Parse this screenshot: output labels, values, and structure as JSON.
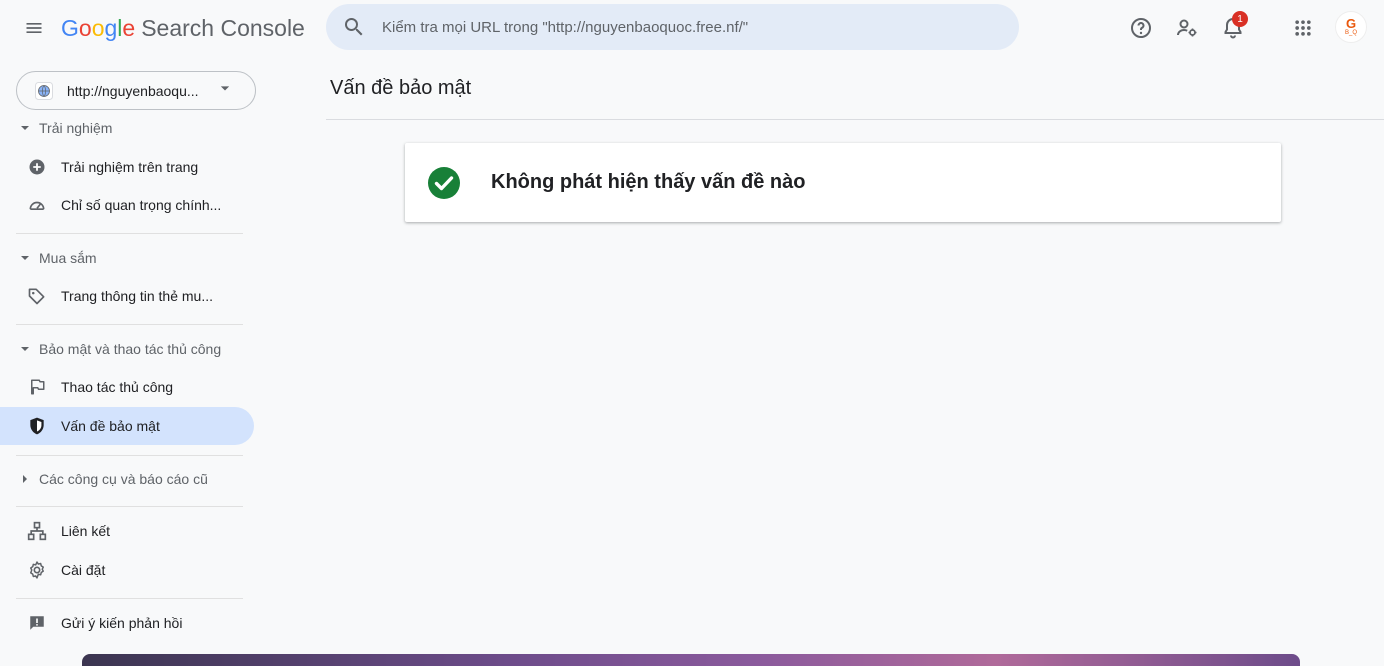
{
  "header": {
    "logo": {
      "g1": "G",
      "g2": "o",
      "g3": "o",
      "g4": "g",
      "g5": "l",
      "g6": "e",
      "product": "Search Console"
    },
    "search_placeholder": "Kiểm tra mọi URL trong \"http://nguyenbaoquoc.free.nf/\"",
    "notification_count": "1",
    "avatar_text": "B_Q",
    "icons": [
      "menu-icon",
      "search-icon",
      "help-icon",
      "manage-users-icon",
      "bell-icon",
      "apps-grid-icon"
    ]
  },
  "sidebar": {
    "property_label": "http://nguyenbaoqu...",
    "sections": [
      {
        "title": "Trải nghiệm",
        "expanded": true,
        "items": [
          {
            "label": "Trải nghiệm trên trang",
            "icon": "plus-circle-icon"
          },
          {
            "label": "Chỉ số quan trọng chính...",
            "icon": "speedometer-icon"
          }
        ]
      },
      {
        "title": "Mua sắm",
        "expanded": true,
        "items": [
          {
            "label": "Trang thông tin thẻ mu...",
            "icon": "tag-icon"
          }
        ]
      },
      {
        "title": "Bảo mật và thao tác thủ công",
        "expanded": true,
        "items": [
          {
            "label": "Thao tác thủ công",
            "icon": "flag-icon"
          },
          {
            "label": "Vấn đề bảo mật",
            "icon": "shield-icon",
            "active": true
          }
        ]
      },
      {
        "title": "Các công cụ và báo cáo cũ",
        "expanded": false,
        "items": []
      }
    ],
    "bottom_items": [
      {
        "label": "Liên kết",
        "icon": "links-icon"
      },
      {
        "label": "Cài đặt",
        "icon": "settings-icon"
      },
      {
        "label": "Gửi ý kiến phản hồi",
        "icon": "feedback-icon"
      }
    ]
  },
  "main": {
    "title": "Vấn đề bảo mật",
    "status_message": "Không phát hiện thấy vấn đề nào",
    "status_icon": "check-circle-icon"
  },
  "colors": {
    "accent": "#1a73e8",
    "active_nav_bg": "#d3e3fd",
    "success_green": "#188038",
    "badge_red": "#d93025"
  }
}
